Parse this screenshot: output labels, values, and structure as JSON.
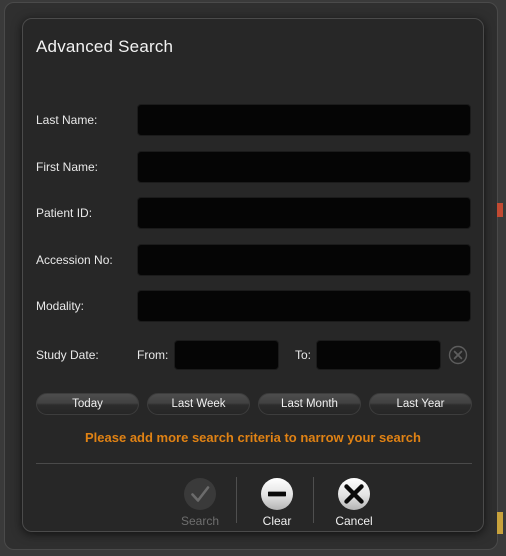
{
  "dialog": {
    "title": "Advanced Search",
    "fields": [
      {
        "label": "Last Name:",
        "value": "",
        "placeholder": "",
        "name": "last-name"
      },
      {
        "label": "First Name:",
        "value": "",
        "placeholder": "",
        "name": "first-name"
      },
      {
        "label": "Patient ID:",
        "value": "",
        "placeholder": "",
        "name": "patient-id"
      },
      {
        "label": "Accession No:",
        "value": "",
        "placeholder": "",
        "name": "accession-no"
      },
      {
        "label": "Modality:",
        "value": "",
        "placeholder": "",
        "name": "modality"
      }
    ],
    "study_date": {
      "label": "Study Date:",
      "from_label": "From:",
      "from_value": "",
      "from_placeholder": "",
      "to_label": "To:",
      "to_value": "",
      "to_placeholder": "",
      "clear_icon": "circle-x-icon"
    },
    "quick_ranges": [
      {
        "label": "Today"
      },
      {
        "label": "Last Week"
      },
      {
        "label": "Last Month"
      },
      {
        "label": "Last Year"
      }
    ],
    "warning": "Please add more search criteria to narrow your search",
    "actions": [
      {
        "label": "Search",
        "icon": "check-circle-icon",
        "enabled": false
      },
      {
        "label": "Clear",
        "icon": "minus-circle-icon",
        "enabled": true
      },
      {
        "label": "Cancel",
        "icon": "x-circle-icon",
        "enabled": true
      }
    ]
  },
  "colors": {
    "warning_orange": "#e08214",
    "dialog_background": "#272727",
    "app_background": "#3a3a3a",
    "input_background": "#050505",
    "edge_sliver_red": "#c24a32",
    "edge_sliver_amber": "#c8a23c"
  }
}
